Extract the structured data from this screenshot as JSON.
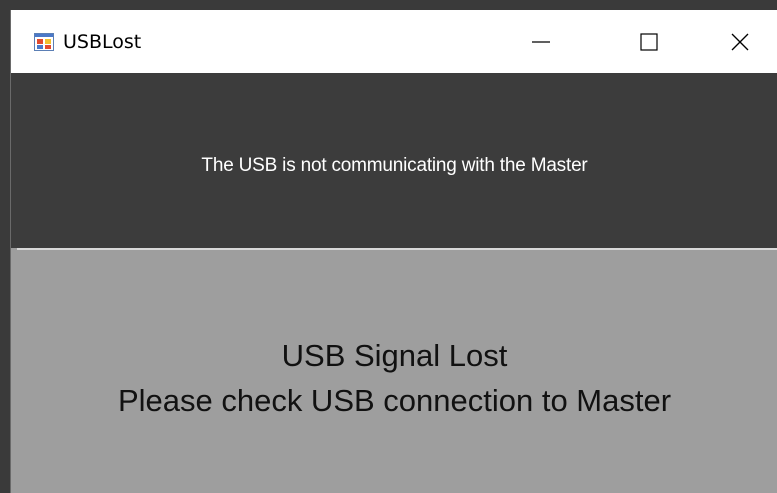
{
  "window": {
    "title": "USBLost",
    "icon": "winforms-app-icon",
    "controls": {
      "minimize_icon": "minimize-icon",
      "maximize_icon": "maximize-icon",
      "close_icon": "close-icon"
    }
  },
  "header": {
    "message": "The USB is not communicating with the Master",
    "background": "#3c3c3c",
    "text_color": "#ffffff"
  },
  "body": {
    "title": "USB Signal Lost",
    "detail": "Please check USB connection to Master",
    "background": "#9e9e9e"
  }
}
